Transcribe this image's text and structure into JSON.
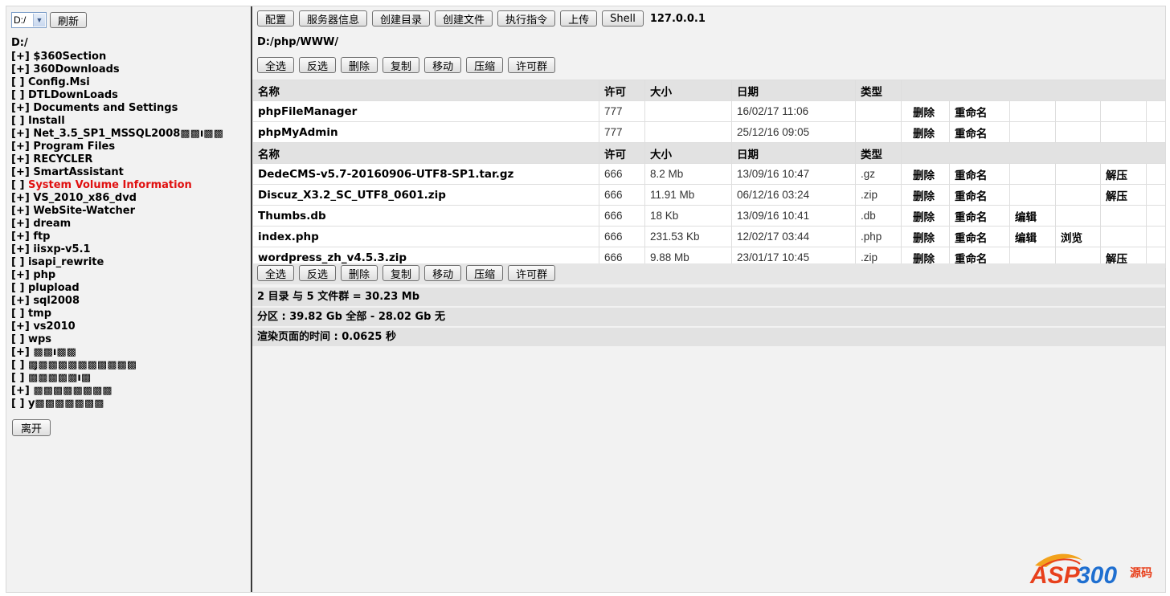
{
  "left": {
    "drive_value": "D:/",
    "refresh_label": "刷新",
    "root_label": "D:/",
    "tree": [
      {
        "prefix": "[+]",
        "name": "$360Section"
      },
      {
        "prefix": "[+]",
        "name": "360Downloads"
      },
      {
        "prefix": "[ ]",
        "name": "Config.Msi"
      },
      {
        "prefix": "[ ]",
        "name": "DTLDownLoads"
      },
      {
        "prefix": "[+]",
        "name": "Documents and Settings"
      },
      {
        "prefix": "[ ]",
        "name": "Install"
      },
      {
        "prefix": "[+]",
        "name": "Net_3.5_SP1_MSSQL2008▩▩ı▩▩"
      },
      {
        "prefix": "[+]",
        "name": "Program Files"
      },
      {
        "prefix": "[+]",
        "name": "RECYCLER"
      },
      {
        "prefix": "[+]",
        "name": "SmartAssistant"
      },
      {
        "prefix": "[ ]",
        "name": "System Volume Information"
      },
      {
        "prefix": "[+]",
        "name": "VS_2010_x86_dvd"
      },
      {
        "prefix": "[+]",
        "name": "WebSite-Watcher"
      },
      {
        "prefix": "[+]",
        "name": "dream"
      },
      {
        "prefix": "[+]",
        "name": "ftp"
      },
      {
        "prefix": "[+]",
        "name": "iisxp-v5.1"
      },
      {
        "prefix": "[ ]",
        "name": "isapi_rewrite"
      },
      {
        "prefix": "[+]",
        "name": "php"
      },
      {
        "prefix": "[ ]",
        "name": "plupload"
      },
      {
        "prefix": "[+]",
        "name": "sql2008"
      },
      {
        "prefix": "[ ]",
        "name": "tmp"
      },
      {
        "prefix": "[+]",
        "name": "vs2010"
      },
      {
        "prefix": "[ ]",
        "name": "wps"
      },
      {
        "prefix": "[+]",
        "name": "▩▩ı▩▩"
      },
      {
        "prefix": "[ ]",
        "name": "▩̧▩▩▩▩▩▩▩▩▩▩"
      },
      {
        "prefix": "[ ]",
        "name": "▩▩▩▩▩ı▩"
      },
      {
        "prefix": "[+]",
        "name": "▩▩▩▩▩▩▩▩"
      },
      {
        "prefix": "[ ]",
        "name": "у▩▩▩▩▩▩▩"
      }
    ],
    "leave_label": "离开"
  },
  "toolbar": {
    "items": [
      "配置",
      "服务器信息",
      "创建目录",
      "创建文件",
      "执行指令",
      "上传",
      "Shell"
    ],
    "host": "127.0.0.1"
  },
  "path": "D:/php/WWW/",
  "actions": [
    "全选",
    "反选",
    "删除",
    "复制",
    "移动",
    "压缩",
    "许可群"
  ],
  "columns": {
    "name": "名称",
    "perm": "许可",
    "size": "大小",
    "date": "日期",
    "type": "类型"
  },
  "dirs": [
    {
      "name": "phpFileManager",
      "perm": "777",
      "size": "",
      "date": "16/02/17 11:06",
      "type": "",
      "delete": "删除",
      "rename": "重命名"
    },
    {
      "name": "phpMyAdmin",
      "perm": "777",
      "size": "",
      "date": "25/12/16 09:05",
      "type": "",
      "delete": "删除",
      "rename": "重命名"
    }
  ],
  "files": [
    {
      "name": "DedeCMS-v5.7-20160906-UTF8-SP1.tar.gz",
      "perm": "666",
      "size": "8.2 Mb",
      "date": "13/09/16 10:47",
      "type": ".gz",
      "delete": "删除",
      "rename": "重命名",
      "edit": "",
      "view": "",
      "extract": "解压"
    },
    {
      "name": "Discuz_X3.2_SC_UTF8_0601.zip",
      "perm": "666",
      "size": "11.91 Mb",
      "date": "06/12/16 03:24",
      "type": ".zip",
      "delete": "删除",
      "rename": "重命名",
      "edit": "",
      "view": "",
      "extract": "解压"
    },
    {
      "name": "Thumbs.db",
      "perm": "666",
      "size": "18 Kb",
      "date": "13/09/16 10:41",
      "type": ".db",
      "delete": "删除",
      "rename": "重命名",
      "edit": "编辑",
      "view": "",
      "extract": ""
    },
    {
      "name": "index.php",
      "perm": "666",
      "size": "231.53 Kb",
      "date": "12/02/17 03:44",
      "type": ".php",
      "delete": "删除",
      "rename": "重命名",
      "edit": "编辑",
      "view": "浏览",
      "extract": ""
    },
    {
      "name": "wordpress_zh_v4.5.3.zip",
      "perm": "666",
      "size": "9.88 Mb",
      "date": "23/01/17 10:45",
      "type": ".zip",
      "delete": "删除",
      "rename": "重命名",
      "edit": "",
      "view": "",
      "extract": "解压"
    }
  ],
  "summary": "2 目录 与 5 文件群 = 30.23 Mb",
  "partition": "分区 : 39.82 Gb 全部 - 28.02 Gb 无",
  "render_time": "渲染页面的时间 : 0.0625 秒",
  "watermark": {
    "text": "ASP300",
    "suffix": "源码",
    "accent": "#e8401c",
    "blue": "#1f6fd0"
  }
}
